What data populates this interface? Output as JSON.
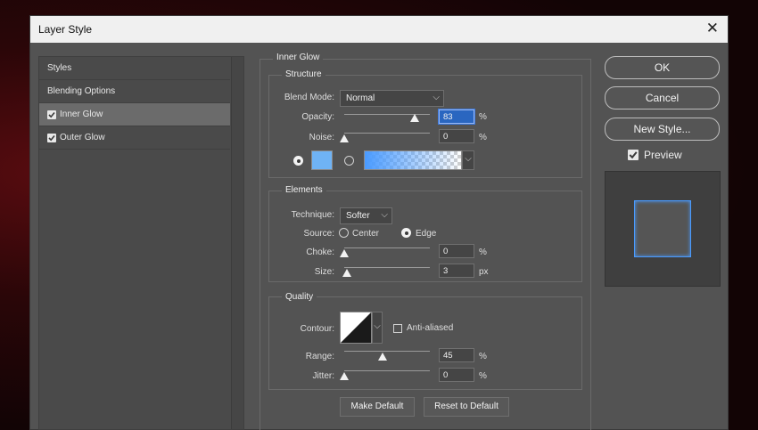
{
  "dialog": {
    "title": "Layer Style",
    "close_label": "✕"
  },
  "styles_list": {
    "items": [
      {
        "label": "Styles",
        "checkbox": false,
        "selected": false
      },
      {
        "label": "Blending Options",
        "checkbox": false,
        "selected": false
      },
      {
        "label": "Inner Glow",
        "checkbox": true,
        "selected": true
      },
      {
        "label": "Outer Glow",
        "checkbox": true,
        "selected": false
      }
    ]
  },
  "inner_glow": {
    "title": "Inner Glow",
    "structure": {
      "title": "Structure",
      "blend_mode_label": "Blend Mode:",
      "blend_mode_value": "Normal",
      "opacity_label": "Opacity:",
      "opacity_value": "83",
      "opacity_unit": "%",
      "noise_label": "Noise:",
      "noise_value": "0",
      "noise_unit": "%",
      "color_swatch": "#6fb3f5"
    },
    "elements": {
      "title": "Elements",
      "technique_label": "Technique:",
      "technique_value": "Softer",
      "source_label": "Source:",
      "source_center": "Center",
      "source_edge": "Edge",
      "choke_label": "Choke:",
      "choke_value": "0",
      "choke_unit": "%",
      "size_label": "Size:",
      "size_value": "3",
      "size_unit": "px"
    },
    "quality": {
      "title": "Quality",
      "contour_label": "Contour:",
      "anti_aliased_label": "Anti-aliased",
      "range_label": "Range:",
      "range_value": "45",
      "range_unit": "%",
      "jitter_label": "Jitter:",
      "jitter_value": "0",
      "jitter_unit": "%"
    },
    "make_default": "Make Default",
    "reset_default": "Reset to Default"
  },
  "actions": {
    "ok": "OK",
    "cancel": "Cancel",
    "new_style": "New Style...",
    "preview_label": "Preview"
  },
  "colors": {
    "accent": "#2a66c0",
    "glow": "#4a9bff"
  }
}
